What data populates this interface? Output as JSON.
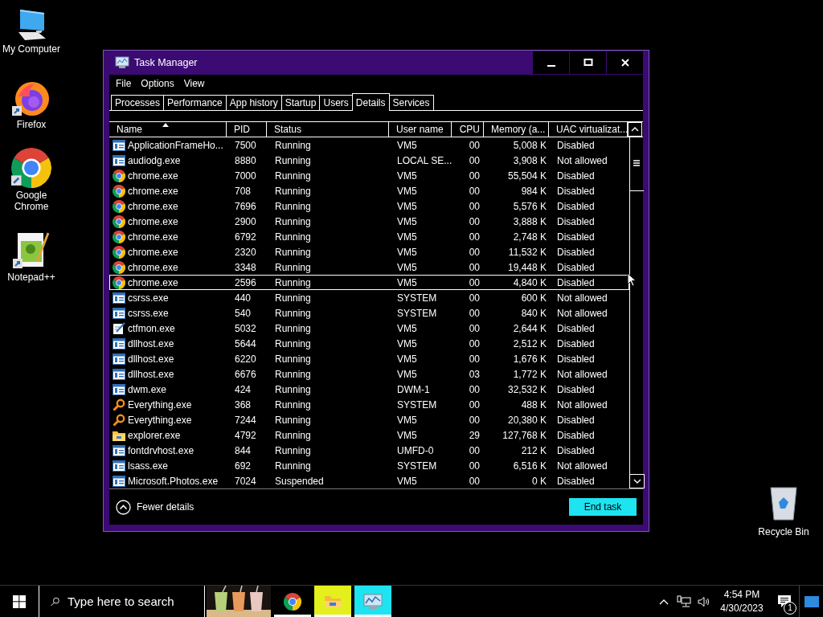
{
  "desktop_icons": [
    {
      "kind": "computer",
      "label": "My Computer"
    },
    {
      "kind": "firefox",
      "label": "Firefox"
    },
    {
      "kind": "chrome",
      "label": "Google Chrome"
    },
    {
      "kind": "notepad",
      "label": "Notepad++"
    }
  ],
  "recycle_bin": {
    "label": "Recycle Bin"
  },
  "window": {
    "title": "Task Manager",
    "menu": [
      "File",
      "Options",
      "View"
    ],
    "tabs": [
      {
        "label": "Processes",
        "selected": false
      },
      {
        "label": "Performance",
        "selected": false
      },
      {
        "label": "App history",
        "selected": false
      },
      {
        "label": "Startup",
        "selected": false
      },
      {
        "label": "Users",
        "selected": false
      },
      {
        "label": "Details",
        "selected": true
      },
      {
        "label": "Services",
        "selected": false
      }
    ],
    "columns": [
      {
        "label": "Name",
        "sorted": true
      },
      {
        "label": "PID",
        "sorted": false
      },
      {
        "label": "Status",
        "sorted": false
      },
      {
        "label": "User name",
        "sorted": false
      },
      {
        "label": "CPU",
        "sorted": false
      },
      {
        "label": "Memory (a...",
        "sorted": false
      },
      {
        "label": "UAC virtualizat...",
        "sorted": false
      }
    ],
    "rows": [
      {
        "kind": "app",
        "name": "ApplicationFrameHo...",
        "pid": "7500",
        "status": "Running",
        "user": "VM5",
        "cpu": "00",
        "memory": "5,008 K",
        "uac": "Disabled",
        "selected": false
      },
      {
        "kind": "app",
        "name": "audiodg.exe",
        "pid": "8880",
        "status": "Running",
        "user": "LOCAL SE...",
        "cpu": "00",
        "memory": "3,908 K",
        "uac": "Not allowed",
        "selected": false
      },
      {
        "kind": "chrome",
        "name": "chrome.exe",
        "pid": "7000",
        "status": "Running",
        "user": "VM5",
        "cpu": "00",
        "memory": "55,504 K",
        "uac": "Disabled",
        "selected": false
      },
      {
        "kind": "chrome",
        "name": "chrome.exe",
        "pid": "708",
        "status": "Running",
        "user": "VM5",
        "cpu": "00",
        "memory": "984 K",
        "uac": "Disabled",
        "selected": false
      },
      {
        "kind": "chrome",
        "name": "chrome.exe",
        "pid": "7696",
        "status": "Running",
        "user": "VM5",
        "cpu": "00",
        "memory": "5,576 K",
        "uac": "Disabled",
        "selected": false
      },
      {
        "kind": "chrome",
        "name": "chrome.exe",
        "pid": "2900",
        "status": "Running",
        "user": "VM5",
        "cpu": "00",
        "memory": "3,888 K",
        "uac": "Disabled",
        "selected": false
      },
      {
        "kind": "chrome",
        "name": "chrome.exe",
        "pid": "6792",
        "status": "Running",
        "user": "VM5",
        "cpu": "00",
        "memory": "2,748 K",
        "uac": "Disabled",
        "selected": false
      },
      {
        "kind": "chrome",
        "name": "chrome.exe",
        "pid": "2320",
        "status": "Running",
        "user": "VM5",
        "cpu": "00",
        "memory": "11,532 K",
        "uac": "Disabled",
        "selected": false
      },
      {
        "kind": "chrome",
        "name": "chrome.exe",
        "pid": "3348",
        "status": "Running",
        "user": "VM5",
        "cpu": "00",
        "memory": "19,448 K",
        "uac": "Disabled",
        "selected": false
      },
      {
        "kind": "chrome",
        "name": "chrome.exe",
        "pid": "2596",
        "status": "Running",
        "user": "VM5",
        "cpu": "00",
        "memory": "4,840 K",
        "uac": "Disabled",
        "selected": true
      },
      {
        "kind": "app",
        "name": "csrss.exe",
        "pid": "440",
        "status": "Running",
        "user": "SYSTEM",
        "cpu": "00",
        "memory": "600 K",
        "uac": "Not allowed",
        "selected": false
      },
      {
        "kind": "app",
        "name": "csrss.exe",
        "pid": "540",
        "status": "Running",
        "user": "SYSTEM",
        "cpu": "00",
        "memory": "840 K",
        "uac": "Not allowed",
        "selected": false
      },
      {
        "kind": "notepad",
        "name": "ctfmon.exe",
        "pid": "5032",
        "status": "Running",
        "user": "VM5",
        "cpu": "00",
        "memory": "2,644 K",
        "uac": "Disabled",
        "selected": false
      },
      {
        "kind": "app",
        "name": "dllhost.exe",
        "pid": "5644",
        "status": "Running",
        "user": "VM5",
        "cpu": "00",
        "memory": "2,512 K",
        "uac": "Disabled",
        "selected": false
      },
      {
        "kind": "app",
        "name": "dllhost.exe",
        "pid": "6220",
        "status": "Running",
        "user": "VM5",
        "cpu": "00",
        "memory": "1,676 K",
        "uac": "Disabled",
        "selected": false
      },
      {
        "kind": "app",
        "name": "dllhost.exe",
        "pid": "6676",
        "status": "Running",
        "user": "VM5",
        "cpu": "03",
        "memory": "1,772 K",
        "uac": "Not allowed",
        "selected": false
      },
      {
        "kind": "app",
        "name": "dwm.exe",
        "pid": "424",
        "status": "Running",
        "user": "DWM-1",
        "cpu": "00",
        "memory": "32,532 K",
        "uac": "Disabled",
        "selected": false
      },
      {
        "kind": "search",
        "name": "Everything.exe",
        "pid": "368",
        "status": "Running",
        "user": "SYSTEM",
        "cpu": "00",
        "memory": "488 K",
        "uac": "Not allowed",
        "selected": false
      },
      {
        "kind": "search",
        "name": "Everything.exe",
        "pid": "7244",
        "status": "Running",
        "user": "VM5",
        "cpu": "00",
        "memory": "20,380 K",
        "uac": "Disabled",
        "selected": false
      },
      {
        "kind": "folder",
        "name": "explorer.exe",
        "pid": "4792",
        "status": "Running",
        "user": "VM5",
        "cpu": "29",
        "memory": "127,768 K",
        "uac": "Disabled",
        "selected": false
      },
      {
        "kind": "app",
        "name": "fontdrvhost.exe",
        "pid": "844",
        "status": "Running",
        "user": "UMFD-0",
        "cpu": "00",
        "memory": "212 K",
        "uac": "Disabled",
        "selected": false
      },
      {
        "kind": "app",
        "name": "lsass.exe",
        "pid": "692",
        "status": "Running",
        "user": "SYSTEM",
        "cpu": "00",
        "memory": "6,516 K",
        "uac": "Not allowed",
        "selected": false
      },
      {
        "kind": "app",
        "name": "Microsoft.Photos.exe",
        "pid": "7024",
        "status": "Suspended",
        "user": "VM5",
        "cpu": "00",
        "memory": "0 K",
        "uac": "Disabled",
        "selected": false
      }
    ],
    "fewer_details": "Fewer details",
    "end_task": "End task"
  },
  "taskbar": {
    "search_placeholder": "Type here to search",
    "apps": [
      {
        "kind": "picture"
      },
      {
        "kind": "chrome",
        "running": true,
        "color": "#000000"
      },
      {
        "kind": "folder",
        "running": true,
        "color": "#e3f01c"
      },
      {
        "kind": "taskmgr",
        "running": true,
        "color": "#1ee3f0"
      }
    ],
    "time": "4:54 PM",
    "date": "4/30/2023",
    "notifications": "1"
  }
}
